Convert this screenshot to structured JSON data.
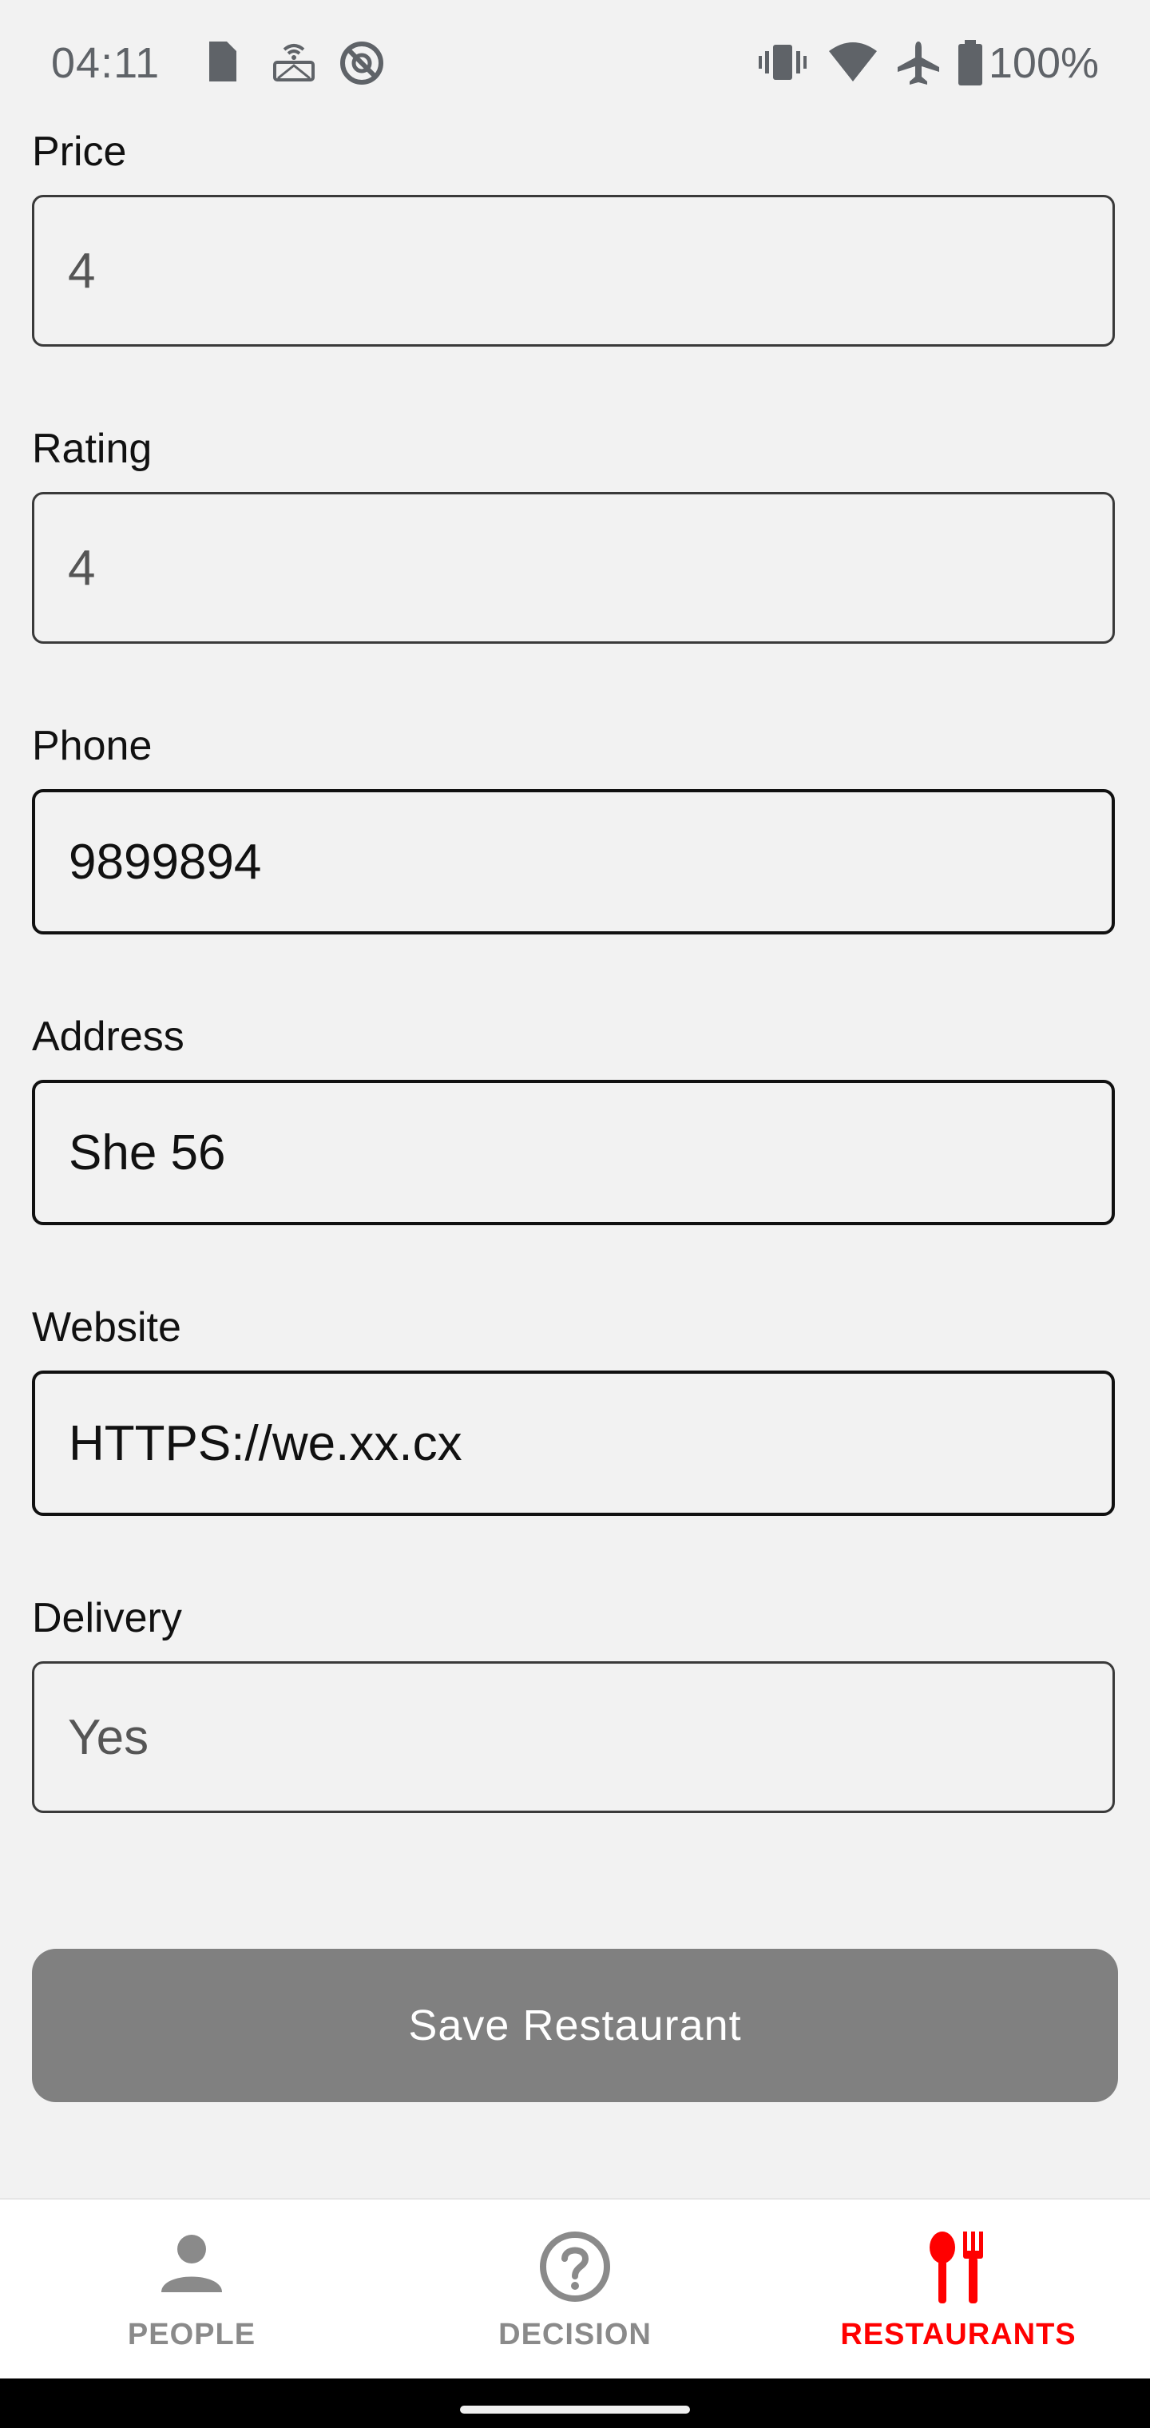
{
  "status_bar": {
    "time": "04:11",
    "battery_text": "100%",
    "icons": [
      "sim-card-icon",
      "cast-icon",
      "data-saver-icon",
      "vibrate-icon",
      "wifi-icon",
      "airplane-icon",
      "battery-icon"
    ]
  },
  "form": {
    "price": {
      "label": "Price",
      "value": "4"
    },
    "rating": {
      "label": "Rating",
      "value": "4"
    },
    "phone": {
      "label": "Phone",
      "value": "9899894"
    },
    "address": {
      "label": "Address",
      "value": "She 56"
    },
    "website": {
      "label": "Website",
      "value": "HTTPS://we.xx.cx"
    },
    "delivery": {
      "label": "Delivery",
      "value": "Yes"
    },
    "save_label": "Save Restaurant"
  },
  "bottom_nav": {
    "items": [
      {
        "label": "PEOPLE",
        "icon": "person-icon",
        "active": false
      },
      {
        "label": "DECISION",
        "icon": "question-circle-icon",
        "active": false
      },
      {
        "label": "RESTAURANTS",
        "icon": "restaurant-icon",
        "active": true
      }
    ],
    "colors": {
      "active": "#ff0000",
      "inactive": "#8a8a8a"
    }
  }
}
